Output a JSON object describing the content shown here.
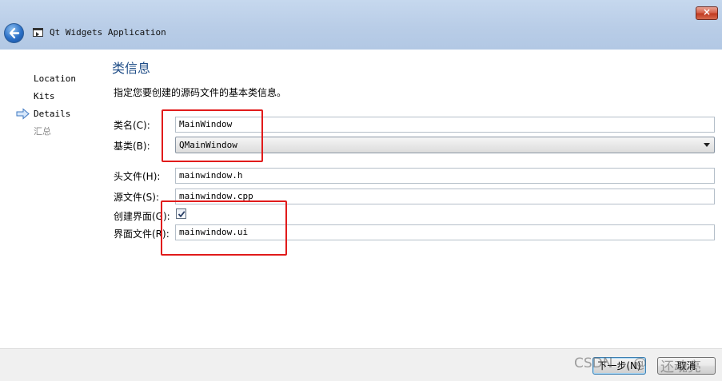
{
  "window": {
    "title": "Qt Widgets Application",
    "close_glyph": "×"
  },
  "wizard": {
    "steps": [
      {
        "label": "Location",
        "current": false,
        "muted": false
      },
      {
        "label": "Kits",
        "current": false,
        "muted": false
      },
      {
        "label": "Details",
        "current": true,
        "muted": false
      },
      {
        "label": "汇总",
        "current": false,
        "muted": true
      }
    ],
    "current_step_icon": "arrow-right-icon"
  },
  "page": {
    "title": "类信息",
    "description": "指定您要创建的源码文件的基本类信息。"
  },
  "form": {
    "class_name": {
      "label": "类名(C):",
      "value": "MainWindow"
    },
    "base_class": {
      "label": "基类(B):",
      "value": "QMainWindow"
    },
    "header_file": {
      "label": "头文件(H):",
      "value": "mainwindow.h"
    },
    "source_file": {
      "label": "源文件(S):",
      "value": "mainwindow.cpp"
    },
    "generate_form": {
      "label": "创建界面(G):",
      "checked": true
    },
    "form_file": {
      "label": "界面文件(R):",
      "value": "mainwindow.ui"
    }
  },
  "buttons": {
    "next": "下一步(N)",
    "cancel": "取消"
  },
  "watermark": {
    "part1": "CSDN",
    "part2": "@",
    "part3": "还魂亮"
  },
  "annotation_color": "#e11b1b"
}
